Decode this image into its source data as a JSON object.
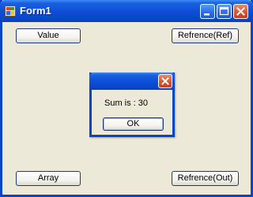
{
  "window": {
    "title": "Form1",
    "buttons": {
      "value": "Value",
      "ref": "Refrence(Ref)",
      "array": "Array",
      "out": "Refrence(Out)"
    }
  },
  "dialog": {
    "message": "Sum is : 30",
    "ok_label": "OK"
  },
  "icons": {
    "app": "form-app-icon",
    "minimize": "minimize-icon",
    "maximize": "maximize-icon",
    "close": "close-icon"
  },
  "colors": {
    "titlebar": "#0b4ed6",
    "window_face": "#ece9d8",
    "close_button": "#d5532e",
    "button_border": "#1e3a78"
  }
}
